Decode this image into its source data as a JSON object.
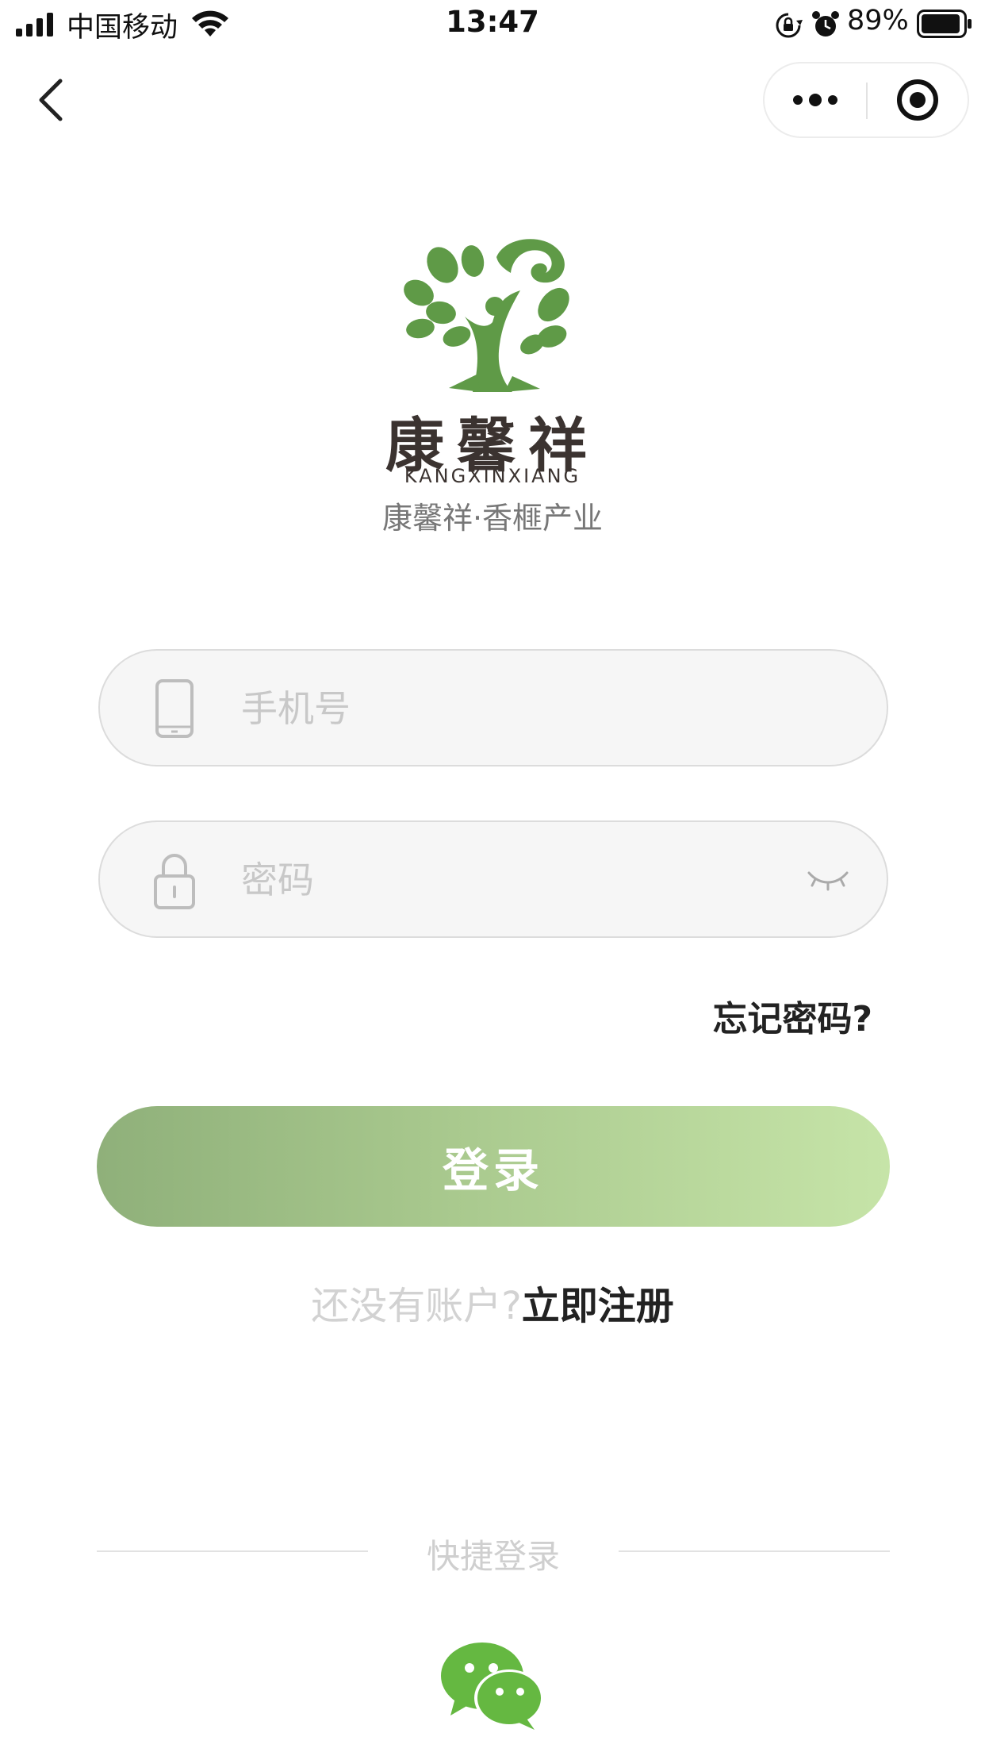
{
  "status_bar": {
    "carrier": "中国移动",
    "time": "13:47",
    "battery": "89%",
    "icons": [
      "signal-icon",
      "wifi-icon",
      "rotation-lock-icon",
      "alarm-icon",
      "battery-icon"
    ]
  },
  "nav": {
    "back_icon": "chevron-left-icon",
    "more_icon": "more-dots-icon",
    "close_icon": "target-close-icon"
  },
  "logo": {
    "brand": "康馨祥",
    "pinyin": "KANGXINXIANG",
    "subtitle": "康馨祥·香榧产业",
    "color": "#5f9a47"
  },
  "form": {
    "phone_placeholder": "手机号",
    "password_placeholder": "密码",
    "forgot": "忘记密码?",
    "login": "登录",
    "register_prompt": "还没有账户?",
    "register_link": "立即注册"
  },
  "quick_login": {
    "label": "快捷登录",
    "wechat_icon": "wechat-icon",
    "wechat_color": "#65b841"
  },
  "colors": {
    "button_gradient_start": "#8fb07a",
    "button_gradient_end": "#c6e4a8"
  }
}
